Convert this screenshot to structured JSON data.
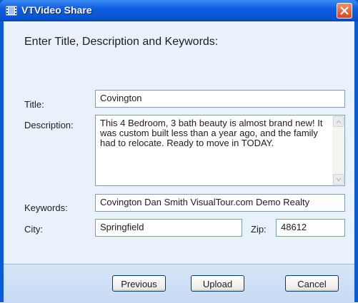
{
  "window": {
    "title": "VTVideo Share"
  },
  "form": {
    "heading": "Enter Title, Description and Keywords:",
    "title_label": "Title:",
    "title_value": "Covington",
    "description_label": "Description:",
    "description_value": "This 4 Bedroom, 3 bath beauty is almost brand new!  It was custom built less than a year ago, and the family had to relocate.  Ready to move in TODAY.",
    "keywords_label": "Keywords:",
    "keywords_value": "Covington Dan Smith VisualTour.com Demo Realty",
    "city_label": "City:",
    "city_value": "Springfield",
    "zip_label": "Zip:",
    "zip_value": "48612"
  },
  "buttons": {
    "previous": "Previous",
    "upload": "Upload",
    "cancel": "Cancel"
  },
  "icons": {
    "app": "film-icon",
    "close": "close-icon",
    "scroll_up": "chevron-up-icon",
    "scroll_down": "chevron-down-icon"
  },
  "colors": {
    "titlebar": "#0a5bd8",
    "close_button": "#e0562a",
    "dialog_background": "#e9f1fb"
  }
}
